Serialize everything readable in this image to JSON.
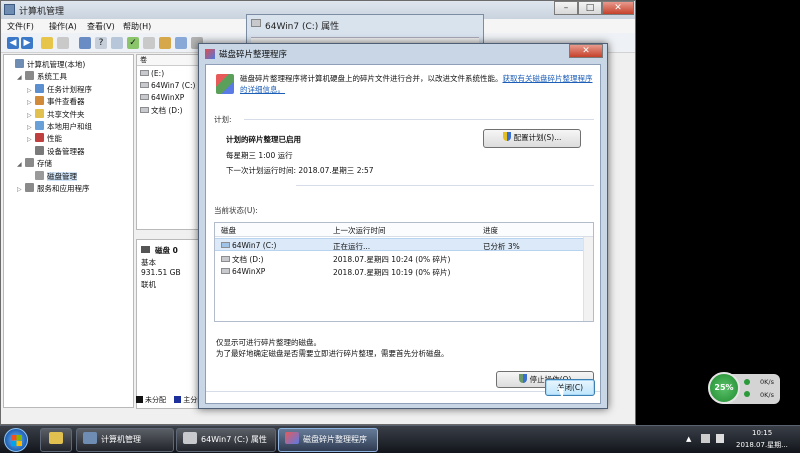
{
  "computer_management": {
    "title": "计算机管理",
    "menu": [
      "文件(F)",
      "操作(A)",
      "查看(V)",
      "帮助(H)"
    ],
    "tree": [
      {
        "label": "计算机管理(本地)",
        "level": 0,
        "expander": "",
        "icon_color": "#6f8db3"
      },
      {
        "label": "系统工具",
        "level": 1,
        "expander": "◢",
        "icon_color": "#8a8a8a"
      },
      {
        "label": "任务计划程序",
        "level": 2,
        "expander": "▷",
        "icon_color": "#5b8fd0"
      },
      {
        "label": "事件查看器",
        "level": 2,
        "expander": "▷",
        "icon_color": "#d08a3a"
      },
      {
        "label": "共享文件夹",
        "level": 2,
        "expander": "▷",
        "icon_color": "#e2c050"
      },
      {
        "label": "本地用户和组",
        "level": 2,
        "expander": "▷",
        "icon_color": "#6aa0d8"
      },
      {
        "label": "性能",
        "level": 2,
        "expander": "▷",
        "icon_color": "#c04040"
      },
      {
        "label": "设备管理器",
        "level": 2,
        "expander": "",
        "icon_color": "#7a7a7a"
      },
      {
        "label": "存储",
        "level": 1,
        "expander": "◢",
        "icon_color": "#8a8a8a"
      },
      {
        "label": "磁盘管理",
        "level": 2,
        "expander": "",
        "icon_color": "#9a9a9a"
      },
      {
        "label": "服务和应用程序",
        "level": 1,
        "expander": "▷",
        "icon_color": "#8a8a8a"
      }
    ],
    "volumes": [
      "(E:)",
      "64Win7 (C:)",
      "64WinXP",
      "文档 (D:)"
    ],
    "disk": {
      "name": "磁盘 0",
      "type": "基本",
      "size": "931.51 GB",
      "status": "联机"
    },
    "legend": [
      "未分配",
      "主分区"
    ]
  },
  "properties_window": {
    "title": "64Win7 (C:) 属性"
  },
  "defrag": {
    "title": "磁盘碎片整理程序",
    "intro": "磁盘碎片整理程序将计算机硬盘上的碎片文件进行合并，以改进文件系统性能。",
    "intro_link": "获取有关磁盘碎片整理程序的详细信息。",
    "schedule_label": "计划:",
    "schedule_status": "计划的碎片整理已启用",
    "schedule_run": "每星期三 1:00 运行",
    "schedule_next": "下一次计划运行时间: 2018.07.星期三 2:57",
    "configure_button": "配置计划(S)...",
    "current_status_label": "当前状态(U):",
    "columns": [
      "磁盘",
      "上一次运行时间",
      "进度"
    ],
    "rows": [
      {
        "disk": "64Win7 (C:)",
        "last_run": "正在运行...",
        "progress": "已分析 3%"
      },
      {
        "disk": "文档 (D:)",
        "last_run": "2018.07.星期四 10:24 (0% 碎片)",
        "progress": ""
      },
      {
        "disk": "64WinXP",
        "last_run": "2018.07.星期四 10:19 (0% 碎片)",
        "progress": ""
      }
    ],
    "note1": "仅显示可进行碎片整理的磁盘。",
    "note2": "为了最好地确定磁盘是否需要立即进行碎片整理，需要首先分析磁盘。",
    "stop_button": "停止操作(O)",
    "close_button": "关闭(C)"
  },
  "gadget": {
    "percent": "25%",
    "up": "0K/s",
    "down": "0K/s"
  },
  "taskbar": {
    "items": [
      "计算机管理",
      "64Win7 (C:) 属性",
      "磁盘碎片整理程序"
    ],
    "time": "10:15",
    "date": "2018.07.星期..."
  },
  "colors": {
    "accent": "#1d5fb8",
    "gadget_green": "#2a9a3a"
  }
}
